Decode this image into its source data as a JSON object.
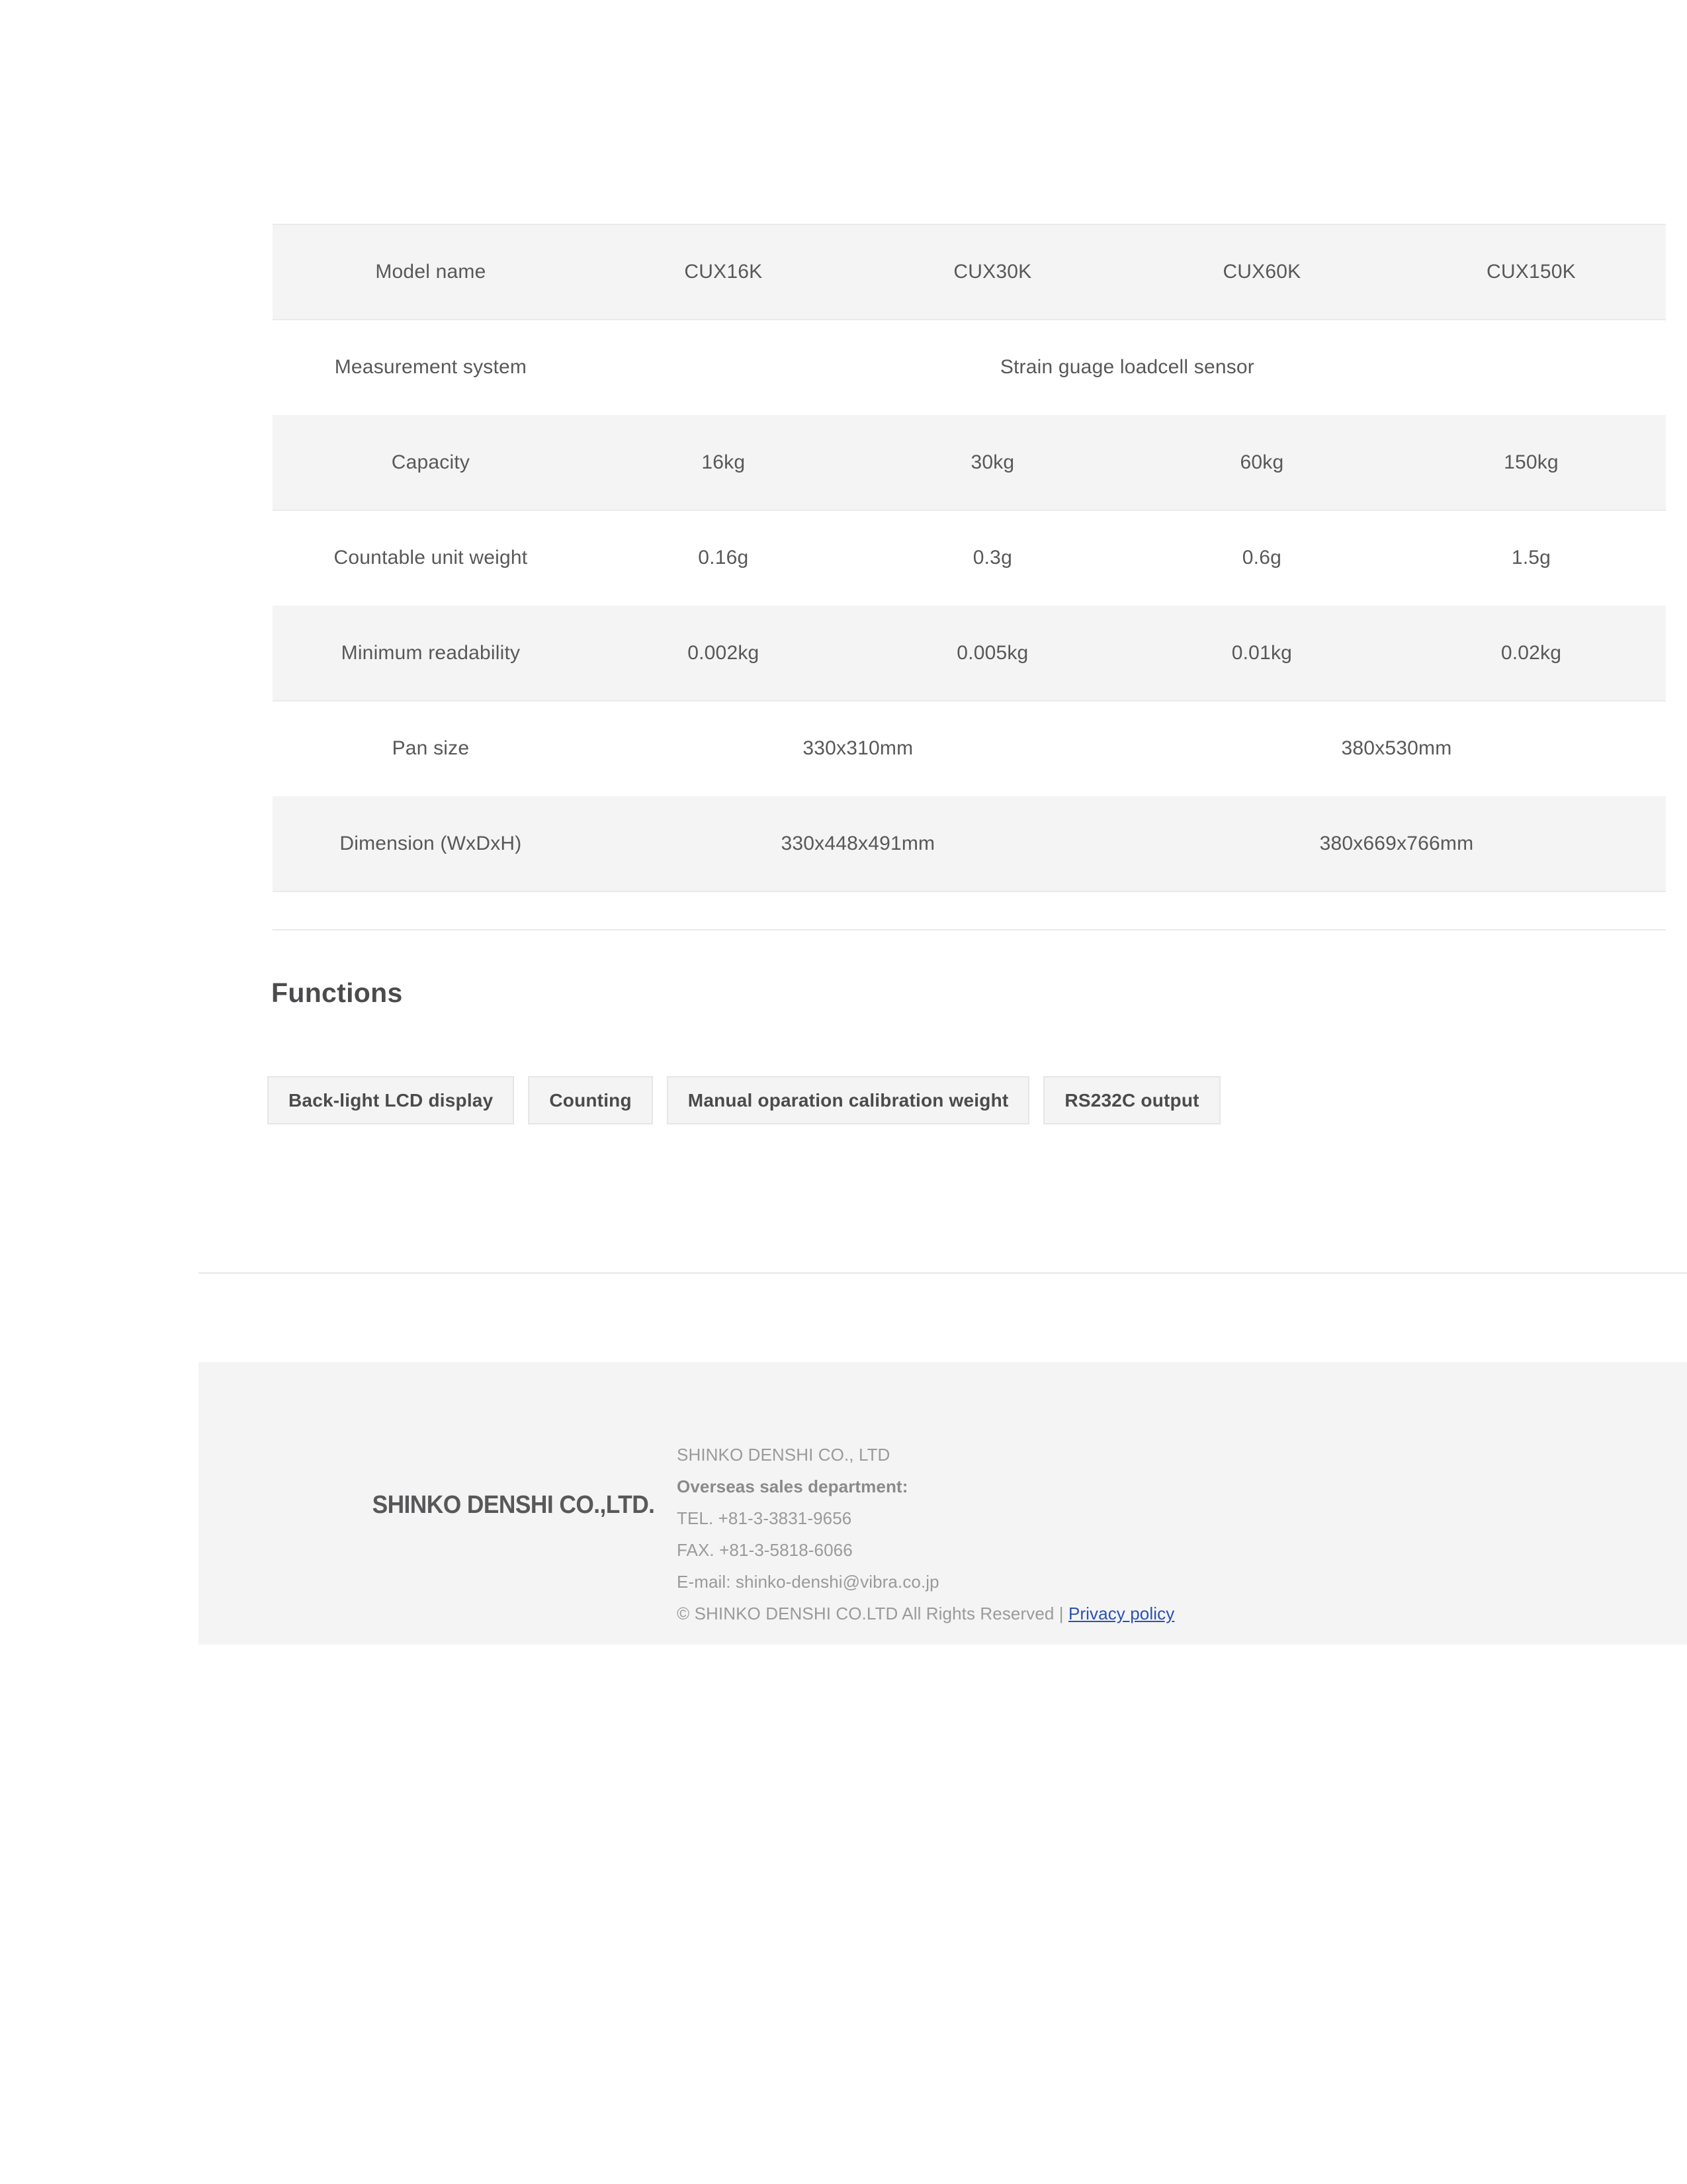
{
  "spec_table": {
    "columns": [
      "Model name",
      "CUX16K",
      "CUX30K",
      "CUX60K",
      "CUX150K"
    ],
    "rows": [
      {
        "label": "Model name",
        "shaded": true,
        "cells": [
          "CUX16K",
          "CUX30K",
          "CUX60K",
          "CUX150K"
        ],
        "span": 1
      },
      {
        "label": "Measurement system",
        "shaded": false,
        "cells": [
          "Strain guage loadcell sensor"
        ],
        "span": 4
      },
      {
        "label": "Capacity",
        "shaded": true,
        "cells": [
          "16kg",
          "30kg",
          "60kg",
          "150kg"
        ],
        "span": 1
      },
      {
        "label": "Countable unit weight",
        "shaded": false,
        "cells": [
          "0.16g",
          "0.3g",
          "0.6g",
          "1.5g"
        ],
        "span": 1
      },
      {
        "label": "Minimum readability",
        "shaded": true,
        "cells": [
          "0.002kg",
          "0.005kg",
          "0.01kg",
          "0.02kg"
        ],
        "span": 1
      },
      {
        "label": "Pan size",
        "shaded": false,
        "cells": [
          "330x310mm",
          "380x530mm"
        ],
        "span": 2
      },
      {
        "label": "Dimension (WxDxH)",
        "shaded": true,
        "cells": [
          "330x448x491mm",
          "380x669x766mm"
        ],
        "span": 2
      }
    ]
  },
  "functions": {
    "heading": "Functions",
    "chips": [
      "Back-light LCD display",
      "Counting",
      "Manual oparation calibration weight",
      "RS232C output"
    ]
  },
  "footer": {
    "logo": "SHINKO DENSHI CO.,LTD.",
    "company": "SHINKO DENSHI CO., LTD",
    "department": "Overseas sales department:",
    "tel": "TEL. +81-3-3831-9656",
    "fax": "FAX. +81-3-5818-6066",
    "email": "E-mail: shinko-denshi@vibra.co.jp",
    "copyright": "© SHINKO DENSHI CO.LTD All Rights Reserved |",
    "privacy_link": "Privacy policy"
  },
  "colors": {
    "text": "#58585a",
    "muted": "#9a9a9c",
    "shade": "#f4f4f4",
    "rule": "#eaeaea",
    "link": "#2a52b0"
  }
}
